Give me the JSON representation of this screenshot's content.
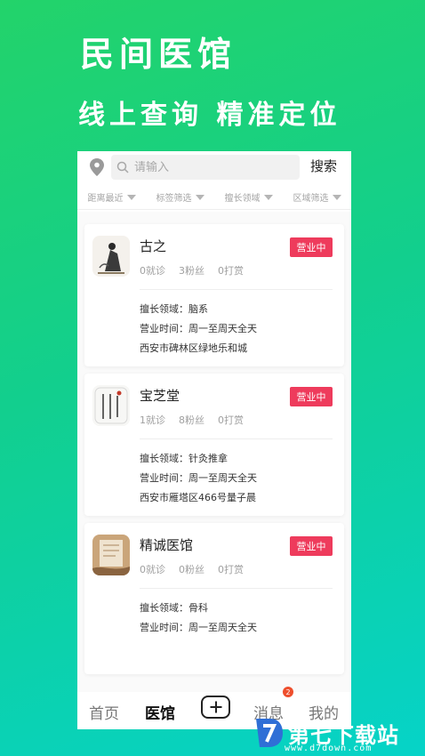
{
  "promo": {
    "title": "民间医馆",
    "subtitle": "线上查询 精准定位"
  },
  "search": {
    "placeholder": "请输入",
    "button_label": "搜索",
    "location_icon": "location-pin-icon",
    "search_icon": "magnifier-icon"
  },
  "filters": [
    {
      "label": "距离最近"
    },
    {
      "label": "标签筛选"
    },
    {
      "label": "擅长领域"
    },
    {
      "label": "区域筛选"
    }
  ],
  "clinics": [
    {
      "name": "古之",
      "consultations": "0就诊",
      "fans": "3粉丝",
      "tips": "0打赏",
      "status": "营业中",
      "specialty": "擅长领域：脑系",
      "hours": "营业时间：周一至周天全天",
      "address": "西安市碑林区绿地乐和城"
    },
    {
      "name": "宝芝堂",
      "consultations": "1就诊",
      "fans": "8粉丝",
      "tips": "0打赏",
      "status": "营业中",
      "specialty": "擅长领域：针灸推拿",
      "hours": "营业时间：周一至周天全天",
      "address": "西安市雁塔区466号量子晨"
    },
    {
      "name": "精诚医馆",
      "consultations": "0就诊",
      "fans": "0粉丝",
      "tips": "0打赏",
      "status": "营业中",
      "specialty": "擅长领域：骨科",
      "hours": "营业时间：周一至周天全天"
    }
  ],
  "tabbar": {
    "home": "首页",
    "clinic": "医馆",
    "messages": "消息",
    "messages_badge": "2",
    "mine": "我的",
    "add_icon": "plus-square-icon"
  },
  "colors": {
    "status_badge": "#ee3b5c",
    "gradient_start": "#23d36a",
    "gradient_end": "#06d3c8"
  },
  "watermark": {
    "title": "第七下载站",
    "url": "www.d7down.com"
  }
}
